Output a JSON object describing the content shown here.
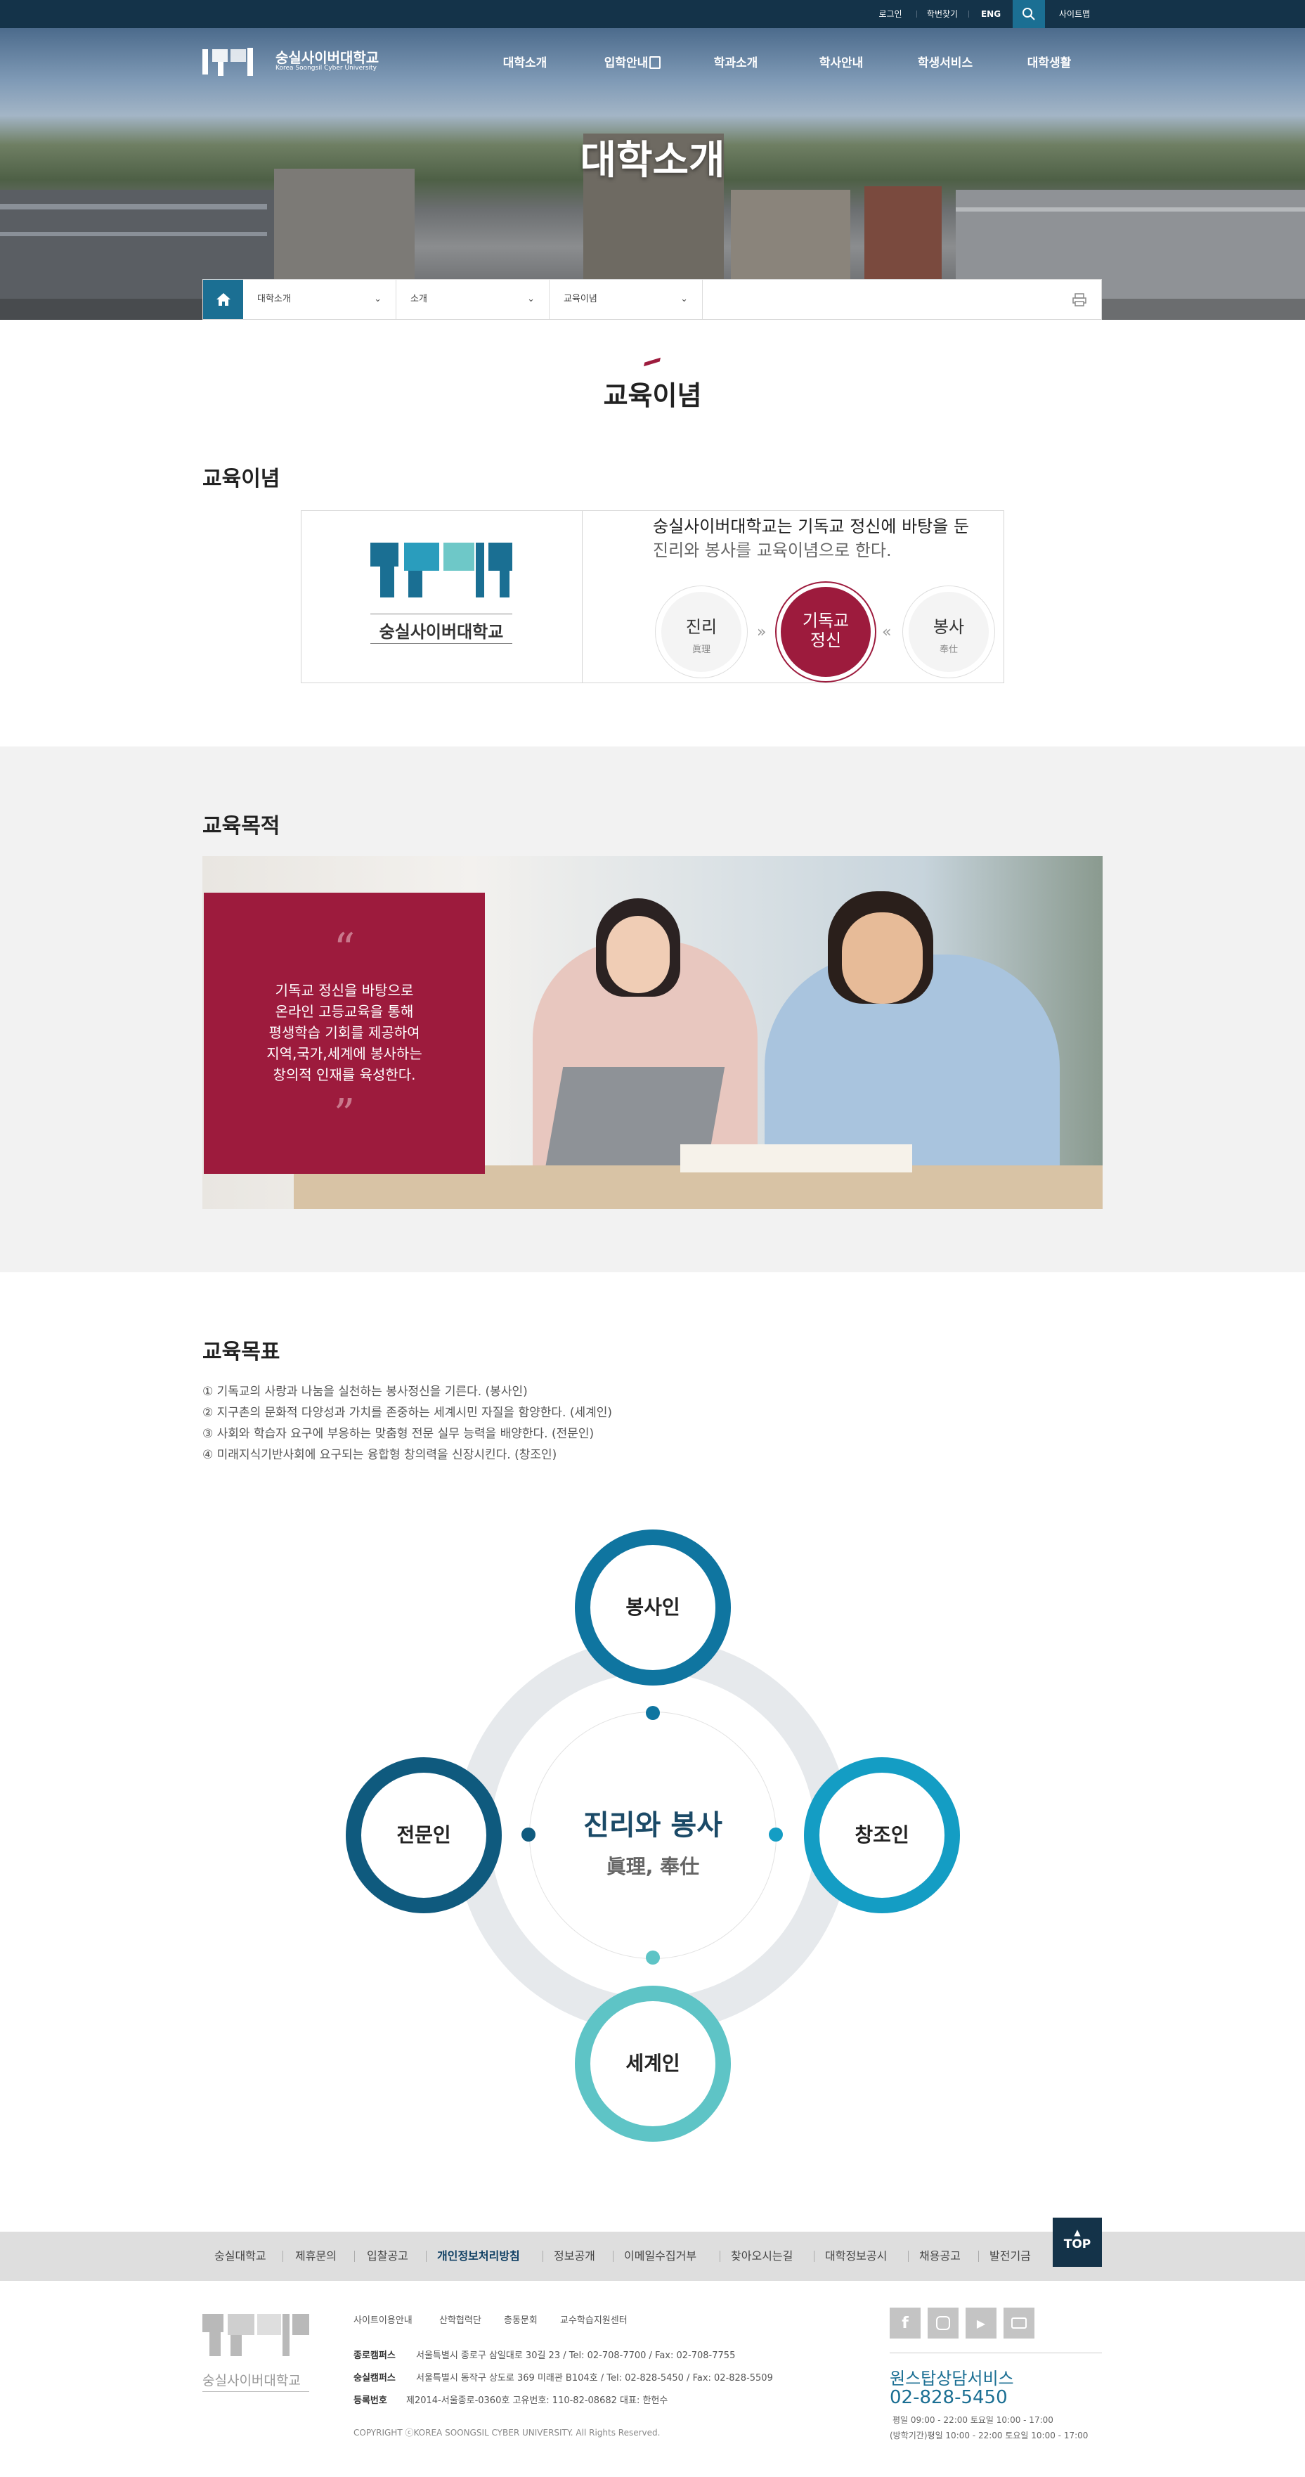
{
  "topbar": {
    "login": "로그인",
    "find_id": "학번찾기",
    "eng": "ENG",
    "sitemap": "사이트맵"
  },
  "header": {
    "logo_kr": "숭실사이버대학교",
    "logo_en": "Korea Soongsil Cyber University",
    "nav": [
      "대학소개",
      "입학안내",
      "학과소개",
      "학사안내",
      "학생서비스",
      "대학생활"
    ]
  },
  "hero": {
    "title": "대학소개"
  },
  "breadcrumb": {
    "level1": "대학소개",
    "level2": "소개",
    "level3": "교육이념"
  },
  "page": {
    "title": "교육이념"
  },
  "philosophy": {
    "heading": "교육이념",
    "logo_name": "숭실사이버대학교",
    "statement_line1": "숭실사이버대학교는 기독교 정신에 바탕을 둔",
    "statement_line2": "진리와 봉사를 교육이념으로 한다.",
    "truth": {
      "title": "진리",
      "hanja": "眞理"
    },
    "center": {
      "line1": "기독교",
      "line2": "정신"
    },
    "service": {
      "title": "봉사",
      "hanja": "奉仕"
    },
    "arrow_left": "»",
    "arrow_right": "«"
  },
  "purpose": {
    "heading": "교육목적",
    "quote_open": "“",
    "quote_close": "”",
    "lines": [
      "기독교 정신을 바탕으로",
      "온라인 고등교육을 통해",
      "평생학습 기회를 제공하여",
      "지역,국가,세계에 봉사하는",
      "창의적 인재를 육성한다."
    ]
  },
  "goals": {
    "heading": "교육목표",
    "items": [
      "① 기독교의 사랑과 나눔을 실천하는 봉사정신을 기른다. (봉사인)",
      "② 지구촌의 문화적 다양성과 가치를 존중하는 세계시민 자질을 함양한다. (세계인)",
      "③ 사회와 학습자 요구에 부응하는 맞춤형 전문 실무 능력을 배양한다. (전문인)",
      "④ 미래지식기반사회에 요구되는 융합형 창의력을 신장시킨다. (창조인)"
    ],
    "diagram": {
      "center_title": "진리와 봉사",
      "center_sub": "眞理, 奉仕",
      "top": "봉사인",
      "left": "전문인",
      "right": "창조인",
      "bottom": "세계인",
      "colors": {
        "top": "#0f75a0",
        "left": "#0f5a7e",
        "right": "#149dc4",
        "bottom": "#5ec4c6"
      }
    }
  },
  "footer": {
    "nav": [
      "숭실대학교",
      "제휴문의",
      "입찰공고",
      "개인정보처리방침",
      "정보공개",
      "이메일수집거부",
      "찾아오시는길",
      "대학정보공시",
      "채용공고",
      "발전기금"
    ],
    "top_button": "TOP",
    "links": [
      "사이트이용안내",
      "산학협력단",
      "총동문회",
      "교수학습지원센터"
    ],
    "logo_name": "숭실사이버대학교",
    "campus1_label": "종로캠퍼스",
    "campus1": "서울특별시 종로구 삼일대로 30길 23 / Tel: 02-708-7700 / Fax: 02-708-7755",
    "campus2_label": "숭실캠퍼스",
    "campus2": "서울특별시 동작구 상도로 369 미래관 B104호 / Tel: 02-828-5450 / Fax: 02-828-5509",
    "reg_label": "등록번호",
    "reg": "제2014-서울종로-0360호  고유번호: 110-82-08682   대표: 한헌수",
    "copyright": "COPYRIGHT ⓒKOREA SOONGSIL CYBER UNIVERSITY. All Rights Reserved.",
    "consult_title": "원스탑상담서비스",
    "consult_phone": "02-828-5450",
    "hours1": "평일 09:00 - 22:00  토요일 10:00 - 17:00",
    "hours2": "(방학기간)평일 10:00 - 22:00  토요일 10:00 - 17:00"
  }
}
